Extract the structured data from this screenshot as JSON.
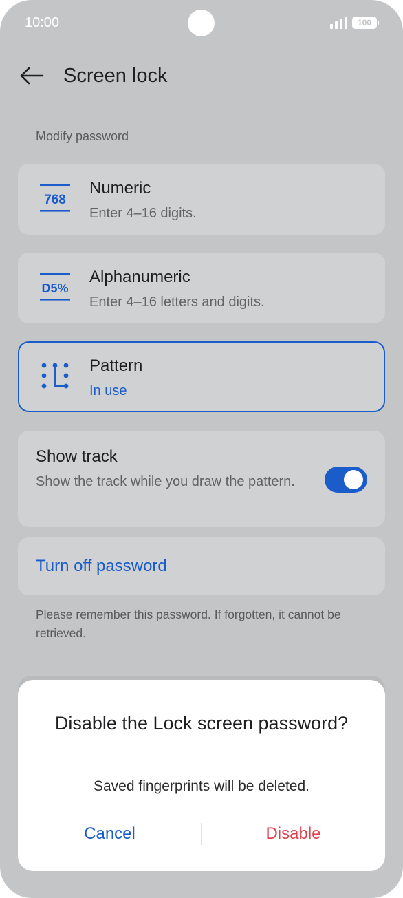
{
  "status_bar": {
    "time": "10:00",
    "battery": "100"
  },
  "header": {
    "title": "Screen lock"
  },
  "section": {
    "label": "Modify password"
  },
  "options": [
    {
      "title": "Numeric",
      "subtitle": "Enter 4–16 digits.",
      "icon_label": "768",
      "icon": "numeric-password-icon"
    },
    {
      "title": "Alphanumeric",
      "subtitle": "Enter 4–16 letters and digits.",
      "icon_label": "D5%",
      "icon": "alphanumeric-password-icon"
    },
    {
      "title": "Pattern",
      "subtitle": "In use",
      "icon": "pattern-icon",
      "selected": true
    }
  ],
  "show_track": {
    "title": "Show track",
    "description": "Show the track while you draw the pattern.",
    "enabled": true
  },
  "turn_off": {
    "label": "Turn off password"
  },
  "note": "Please remember this password. If forgotten, it cannot be retrieved.",
  "dialog": {
    "title": "Disable the Lock screen password?",
    "message": "Saved fingerprints will be deleted.",
    "cancel": "Cancel",
    "confirm": "Disable"
  },
  "colors": {
    "accent": "#1a5cc9",
    "destructive": "#e0414f",
    "background_dimmed": "#c4c5c7",
    "card": "#d0d1d3"
  }
}
